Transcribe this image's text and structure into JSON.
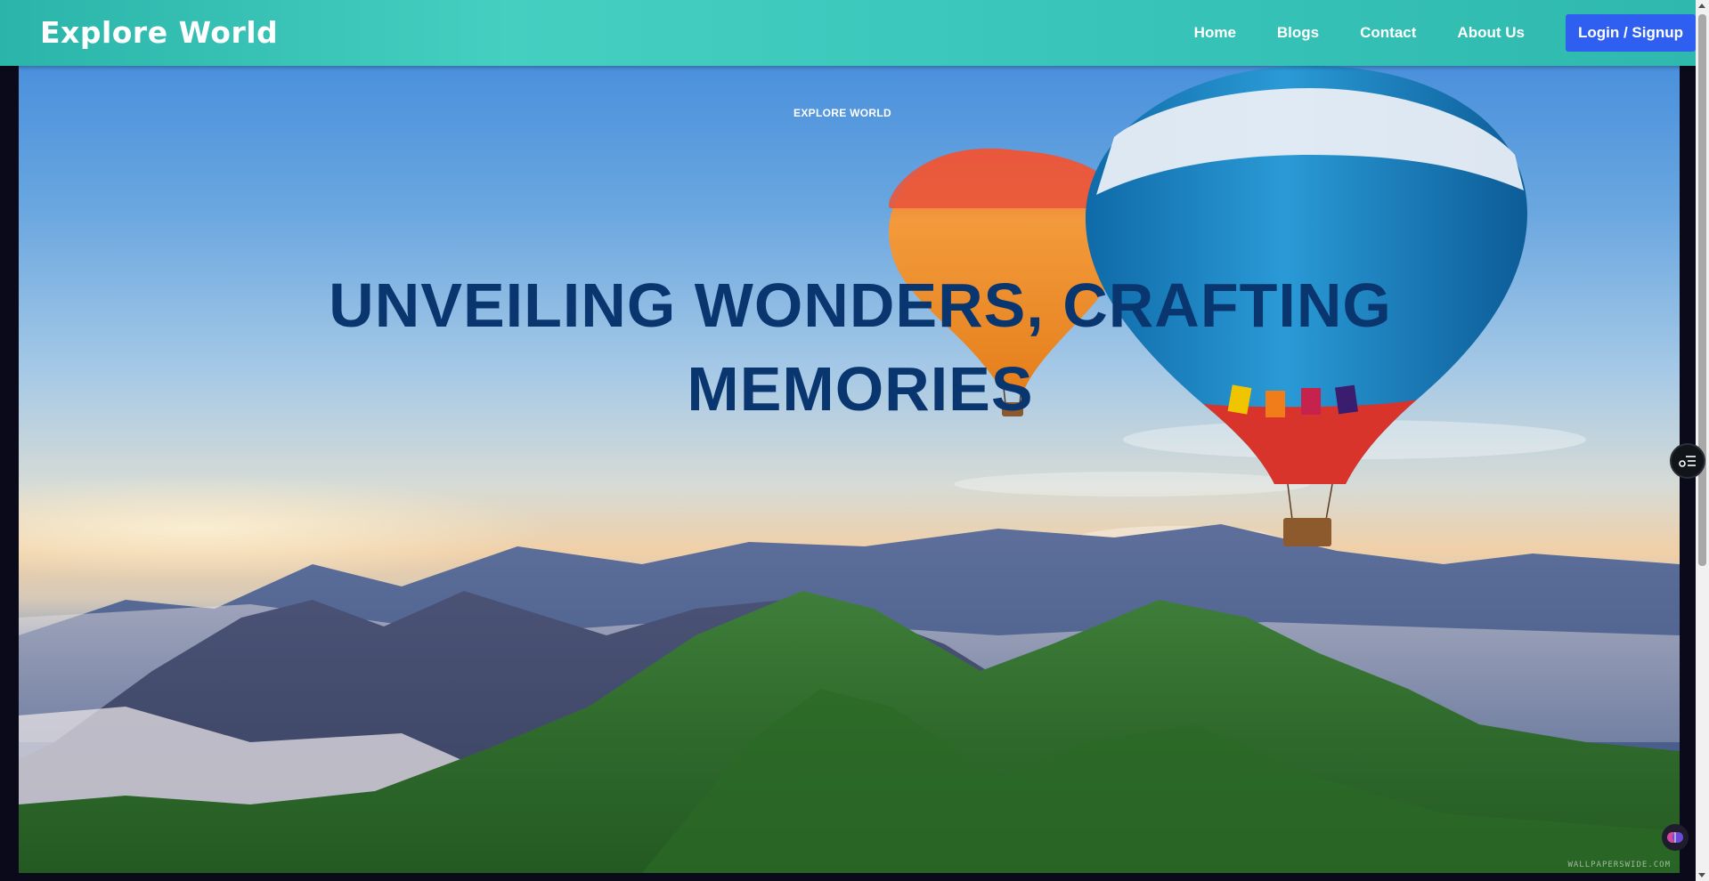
{
  "header": {
    "brand": "Explore World",
    "nav": {
      "home": "Home",
      "blogs": "Blogs",
      "contact": "Contact",
      "about": "About Us"
    },
    "login_label": "Login / Signup"
  },
  "hero": {
    "eyebrow": "EXPLORE WORLD",
    "headline": "UNVEILING WONDERS, CRAFTING MEMORIES"
  },
  "colors": {
    "navbar": "#3ac6bb",
    "login_button": "#2f5ff0",
    "headline": "#0a3670"
  },
  "icons": {
    "floating_menu": "settings-list-icon",
    "extension": "brain-icon"
  }
}
